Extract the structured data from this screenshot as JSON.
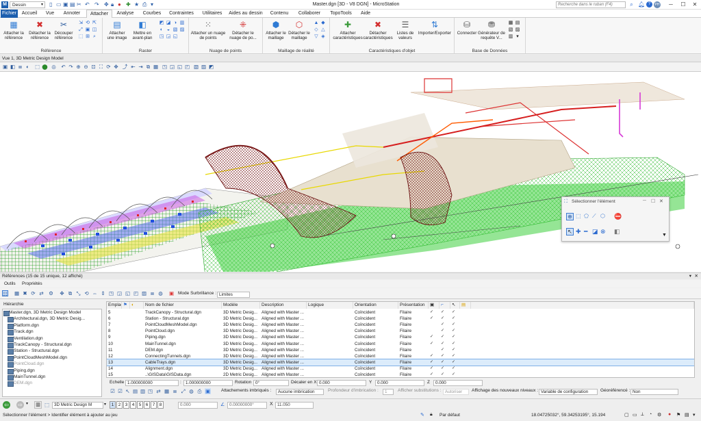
{
  "title_bar": {
    "workspace": "Dessin",
    "title": "Master.dgn [3D - V8 DGN] - MicroStation",
    "search_placeholder": "Recherche dans le ruban (F4)"
  },
  "tabs": [
    "Fichier",
    "Accueil",
    "Vue",
    "Annoter",
    "Attacher",
    "Analyse",
    "Courbes",
    "Contraintes",
    "Utilitaires",
    "Aides au dessin",
    "Contenu",
    "Collaborer",
    "TopoTools",
    "Aide"
  ],
  "active_tab": "Attacher",
  "ribbon": {
    "groups": [
      {
        "label": "Référence",
        "buttons": [
          "Attacher la référence",
          "Détacher la référence",
          "Découper référence"
        ]
      },
      {
        "label": "Raster",
        "buttons": [
          "Attacher une image",
          "Mettre en avant-plan"
        ]
      },
      {
        "label": "Nuage de points",
        "buttons": [
          "Attacher un nuage de points",
          "Détacher le nuage de po..."
        ]
      },
      {
        "label": "Maillage de réalité",
        "buttons": [
          "Attacher le maillage",
          "Détacher le maillage"
        ]
      },
      {
        "label": "Caractéristiques d'objet",
        "buttons": [
          "Attacher caractéristiques",
          "Détacher caractéristiques",
          "Listes de valeurs",
          "Importer/Exporter"
        ]
      },
      {
        "label": "Base de Données",
        "buttons": [
          "Connecter",
          "Générateur de requête V..."
        ]
      }
    ]
  },
  "view": {
    "title": "Vue 1, 3D Metric Design Model"
  },
  "select_element": {
    "title": "Sélectionner l'élément"
  },
  "references": {
    "header": "Références (15 de 15 unique, 12 affiché)",
    "menu": [
      "Outils",
      "Propriétés"
    ],
    "surbrillance_label": "Mode Surbrillance :",
    "surbrillance_value": "Limites",
    "hierarchy_label": "Hiérarchie",
    "hierarchy": [
      {
        "name": "Master.dgn, 3D Metric Design Model",
        "root": true
      },
      {
        "name": "Architectural.dgn, 3D Metric Desig..."
      },
      {
        "name": "Platform.dgn"
      },
      {
        "name": "Track.dgn"
      },
      {
        "name": "Ventilation.dgn"
      },
      {
        "name": "TrackCanopy - Structural.dgn"
      },
      {
        "name": "Station - Structural.dgn"
      },
      {
        "name": "PointCloudMeshModel.dgn"
      },
      {
        "name": "PointCloud.dgn",
        "dim": true
      },
      {
        "name": "Piping.dgn"
      },
      {
        "name": "MainTunnel.dgn"
      },
      {
        "name": "DEM.dgn",
        "dim": true
      }
    ],
    "columns": [
      "Emplac",
      "Nom de fichier",
      "Modèle",
      "Description",
      "Logique",
      "Orientation",
      "Présentation"
    ],
    "rows": [
      {
        "n": "5",
        "file": "TrackCanopy - Structural.dgn",
        "model": "3D Metric Desig...",
        "desc": "Aligned with Master ...",
        "orient": "Coïncident",
        "pres": "Filaire",
        "c1": "✓",
        "c2": "✓",
        "c3": "✓"
      },
      {
        "n": "6",
        "file": "Station - Structural.dgn",
        "model": "3D Metric Desig...",
        "desc": "Aligned with Master ...",
        "orient": "Coïncident",
        "pres": "Filaire",
        "c1": "✓",
        "c2": "✓",
        "c3": "✓"
      },
      {
        "n": "7",
        "file": "PointCloudMeshModel.dgn",
        "model": "3D Metric Desig...",
        "desc": "Aligned with Master ...",
        "orient": "Coïncident",
        "pres": "Filaire",
        "c1": "",
        "c2": "✓",
        "c3": "✓"
      },
      {
        "n": "8",
        "file": "PointCloud.dgn",
        "model": "3D Metric Desig...",
        "desc": "Aligned with Master ...",
        "orient": "Coïncident",
        "pres": "Filaire",
        "c1": "",
        "c2": "✓",
        "c3": "✓"
      },
      {
        "n": "9",
        "file": "Piping.dgn",
        "model": "3D Metric Desig...",
        "desc": "Aligned with Master ...",
        "orient": "Coïncident",
        "pres": "Filaire",
        "c1": "✓",
        "c2": "✓",
        "c3": "✓"
      },
      {
        "n": "10",
        "file": "MainTunnel.dgn",
        "model": "3D Metric Desig...",
        "desc": "Aligned with Master ...",
        "orient": "Coïncident",
        "pres": "Filaire",
        "c1": "✓",
        "c2": "✓",
        "c3": "✓"
      },
      {
        "n": "11",
        "file": "DEM.dgn",
        "model": "3D Metric Desig...",
        "desc": "Aligned with Master ...",
        "orient": "Coïncident",
        "pres": "Filaire",
        "c1": "",
        "c2": "✓",
        "c3": "✓"
      },
      {
        "n": "12",
        "file": "ConnectingTunnels.dgn",
        "model": "3D Metric Desig...",
        "desc": "Aligned with Master ...",
        "orient": "Coïncident",
        "pres": "Filaire",
        "c1": "✓",
        "c2": "✓",
        "c3": "✓"
      },
      {
        "n": "13",
        "file": "CableTrays.dgn",
        "model": "3D Metric Desig...",
        "desc": "Aligned with Master ...",
        "orient": "Coïncident",
        "pres": "Filaire",
        "c1": "✓",
        "c2": "✓",
        "c3": "✓",
        "selected": true
      },
      {
        "n": "14",
        "file": "Alignment.dgn",
        "model": "3D Metric Desig...",
        "desc": "Aligned with Master ...",
        "orient": "Coïncident",
        "pres": "Filaire",
        "c1": "✓",
        "c2": "✓",
        "c3": "✓"
      },
      {
        "n": "15",
        "file": "..\\GISData\\GISData.dgn",
        "model": "2D Metric Desig...",
        "desc": "Aligned with Master ...",
        "orient": "Coïncident",
        "pres": "Filaire",
        "c1": "✓",
        "c2": "✓",
        "c3": "✓"
      }
    ],
    "fields": {
      "echelle_label": "Echelle",
      "echelle_a": "1.000000000",
      "echelle_b": "1.000000000",
      "rotation_label": "Rotation",
      "rotation": "0°",
      "decaler_label": "Décaler en X",
      "x": "0.000",
      "y_label": "Y",
      "y": "0.000",
      "z_label": "Z",
      "z": "0.000",
      "attach_label": "Attachements imbriqués :",
      "attach_value": "Aucune imbrication",
      "prof_label": "Profondeur d'imbrication :",
      "prof_value": "1",
      "subst_label": "Afficher substitutions :",
      "subst_value": "Autoriser",
      "levels_label": "Affichage des nouveaux niveaux :",
      "levels_value": "Variable de configuration",
      "georef_label": "Géoréférencé :",
      "georef_value": "Non"
    }
  },
  "status": {
    "model": "3D Metric Design M",
    "views": [
      "1",
      "2",
      "3",
      "4",
      "5",
      "6",
      "7",
      "8"
    ],
    "field_a": "0.000",
    "field_b": "0.00000000°",
    "x_label": "X",
    "x_value": "11.050",
    "prompt": "Sélectionner l'élément > Identifier élément à ajouter au jeu",
    "level": "Par défaut",
    "coords": "18.04725032°, 59.34253195°, 15.194"
  }
}
